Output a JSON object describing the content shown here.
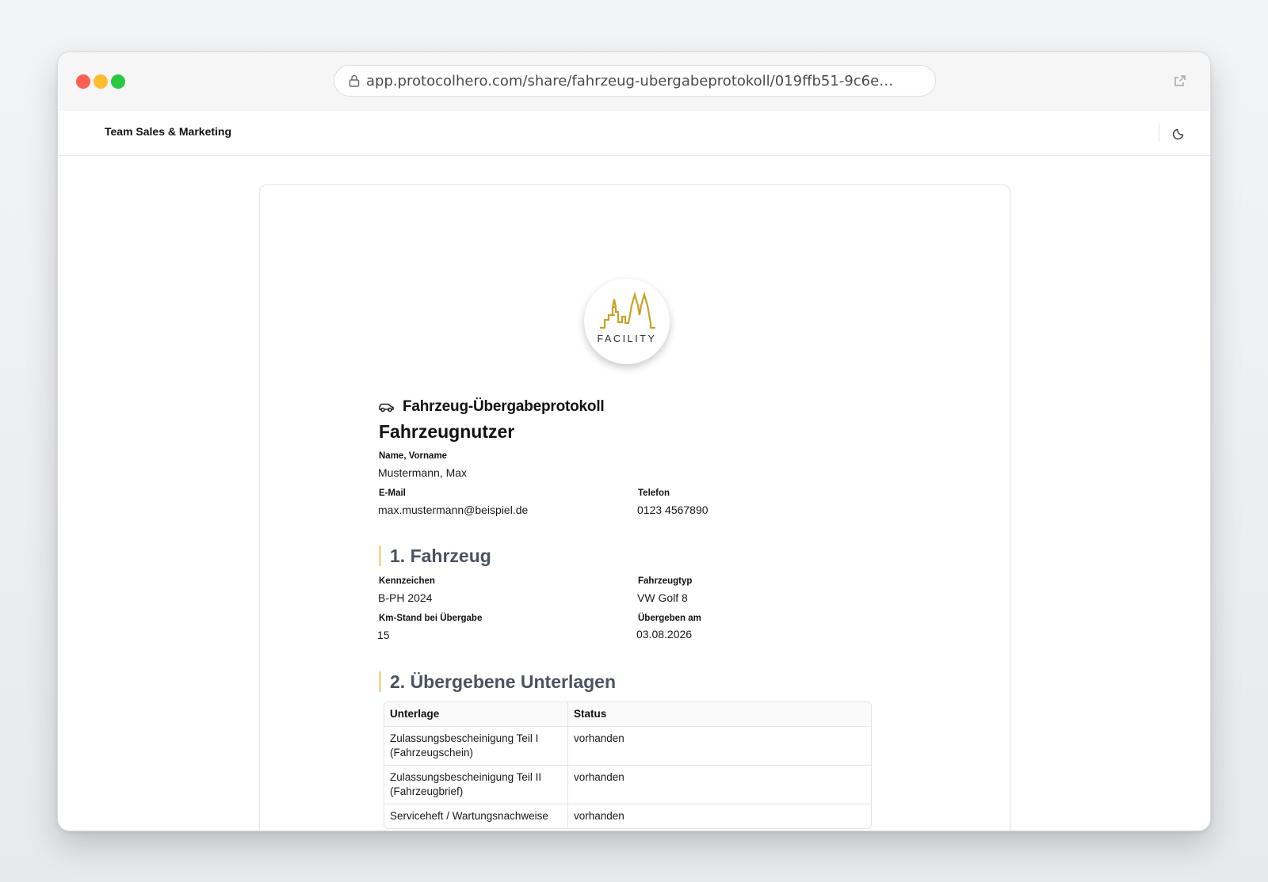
{
  "browser": {
    "url": "app.protocolhero.com/share/fahrzeug-ubergabeprotokoll/019ffb51-9c6e…"
  },
  "app": {
    "team_name": "Team Sales & Marketing"
  },
  "logo": {
    "text": "FACILITY",
    "accent_color": "#c9a227"
  },
  "document": {
    "type_label": "Fahrzeug-Übergabeprotokoll",
    "user_section": {
      "title": "Fahrzeugnutzer",
      "name_label": "Name, Vorname",
      "name_value": "Mustermann, Max",
      "email_label": "E-Mail",
      "email_value": "max.mustermann@beispiel.de",
      "phone_label": "Telefon",
      "phone_value": "0123 4567890"
    },
    "vehicle_section": {
      "title": "1. Fahrzeug",
      "plate_label": "Kennzeichen",
      "plate_value": "B-PH 2024",
      "type_label": "Fahrzeugtyp",
      "type_value": "VW Golf 8",
      "km_label": "Km-Stand bei Übergabe",
      "km_value": "15",
      "date_label": "Übergeben am",
      "date_value": "03.08.2026"
    },
    "documents_section": {
      "title": "2. Übergebene Unterlagen",
      "columns": [
        "Unterlage",
        "Status"
      ],
      "rows": [
        {
          "item": "Zulassungsbescheinigung Teil I (Fahrzeugschein)",
          "status": "vorhanden"
        },
        {
          "item": "Zulassungsbescheinigung Teil II (Fahrzeugbrief)",
          "status": "vorhanden"
        },
        {
          "item": "Serviceheft / Wartungsnachweise",
          "status": "vorhanden"
        }
      ]
    }
  }
}
